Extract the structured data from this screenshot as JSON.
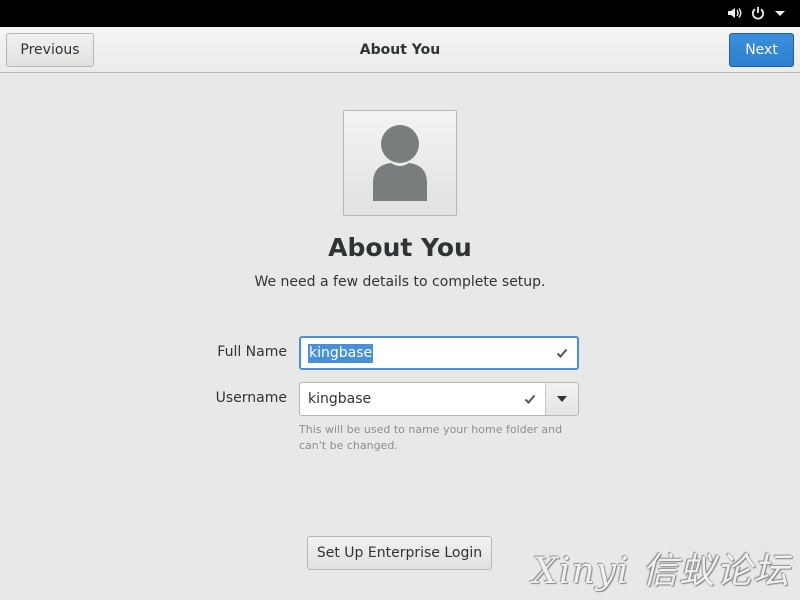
{
  "topbar": {
    "icons": [
      "volume-icon",
      "power-icon",
      "menu-arrow-icon"
    ]
  },
  "header": {
    "previous_label": "Previous",
    "title": "About You",
    "next_label": "Next"
  },
  "main": {
    "avatar_icon": "user-avatar-icon",
    "title": "About You",
    "subtitle": "We need a few details to complete setup.",
    "full_name": {
      "label": "Full Name",
      "value": "kingbase",
      "selected": true
    },
    "username": {
      "label": "Username",
      "value": "kingbase"
    },
    "hint": "This will be used to name your home folder and can't be changed.",
    "enterprise_button": "Set Up Enterprise Login"
  },
  "watermark": "Xinyi 信蚁论坛",
  "colors": {
    "accent": "#4a90d9",
    "next_button": "#3584e4",
    "background": "#e8e8e7",
    "topbar": "#000000"
  }
}
